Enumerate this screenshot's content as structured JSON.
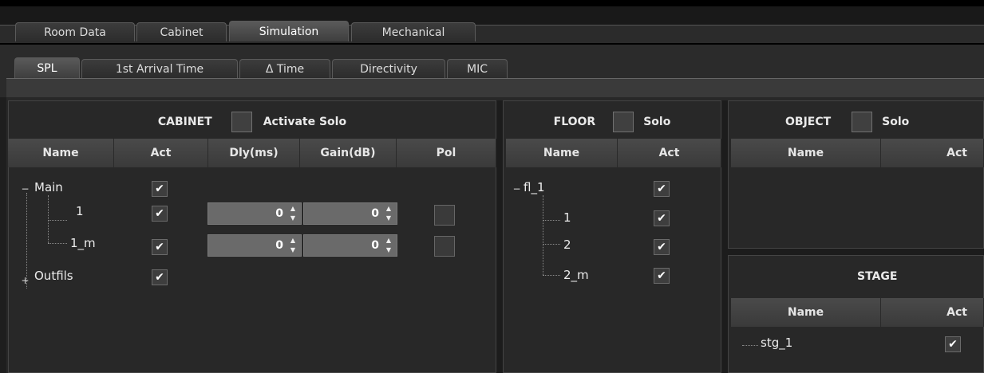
{
  "main_tabs": [
    "Room Data",
    "Cabinet",
    "Simulation",
    "Mechanical"
  ],
  "sub_tabs": [
    "SPL",
    "1st Arrival Time",
    "Δ Time",
    "Directivity",
    "MIC"
  ],
  "cabinet": {
    "title": "CABINET",
    "solo_label": "Activate Solo",
    "columns": [
      "Name",
      "Act",
      "Dly(ms)",
      "Gain(dB)",
      "Pol"
    ],
    "rows": [
      {
        "name": "Main",
        "expander": "−",
        "act": "✔"
      },
      {
        "name": "1",
        "act": "✔",
        "dly": "0",
        "gain": "0"
      },
      {
        "name": "1_m",
        "act": "✔",
        "dly": "0",
        "gain": "0"
      },
      {
        "name": "Outfils",
        "expander": "+",
        "act": "✔"
      }
    ]
  },
  "floor": {
    "title": "FLOOR",
    "solo_label": "Solo",
    "columns": [
      "Name",
      "Act"
    ],
    "rows": [
      {
        "name": "fl_1",
        "expander": "−",
        "act": "✔"
      },
      {
        "name": "1",
        "act": "✔"
      },
      {
        "name": "2",
        "act": "✔"
      },
      {
        "name": "2_m",
        "act": "✔"
      }
    ]
  },
  "object": {
    "title": "OBJECT",
    "solo_label": "Solo",
    "columns": [
      "Name",
      "Act"
    ]
  },
  "stage": {
    "title": "STAGE",
    "columns": [
      "Name",
      "Act"
    ],
    "rows": [
      {
        "name": "stg_1",
        "act": "✔"
      }
    ]
  },
  "icons": {
    "spin_up": "▲",
    "spin_down": "▼"
  }
}
